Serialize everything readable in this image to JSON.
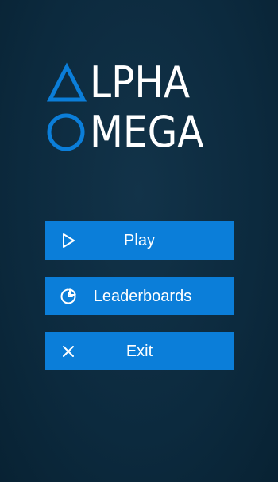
{
  "logo": {
    "line1_rest": "LPHA",
    "line2_rest": "MEGA",
    "accent_color": "#0b7ed9"
  },
  "menu": {
    "play_label": "Play",
    "leaderboards_label": "Leaderboards",
    "exit_label": "Exit",
    "button_color": "#0b7ed9"
  },
  "icons": {
    "play": "play-icon",
    "leaderboards": "pie-chart-icon",
    "exit": "close-icon"
  }
}
